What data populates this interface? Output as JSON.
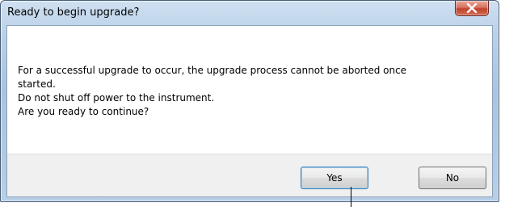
{
  "dialog": {
    "title": "Ready to begin upgrade?",
    "close_icon": "close-icon",
    "message_lines": [
      "For a successful upgrade to occur, the upgrade process cannot be aborted once",
      "started.",
      "Do not shut off power to the instrument.",
      "Are you ready to continue?"
    ],
    "buttons": {
      "yes": "Yes",
      "no": "No"
    }
  },
  "colors": {
    "close_button": "#c0412c",
    "frame": "#a8c4e0",
    "default_button_border": "#3c7fb1"
  }
}
